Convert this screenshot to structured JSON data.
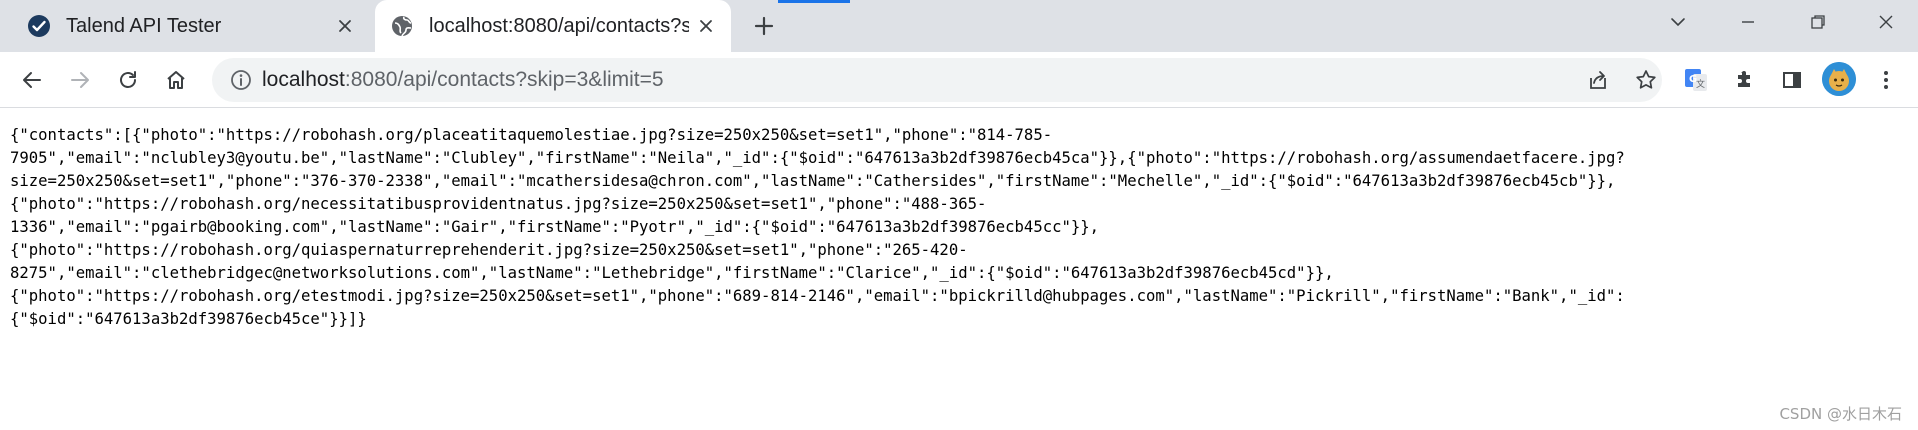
{
  "tabs": [
    {
      "title": "Talend API Tester",
      "favicon": "talend-check-icon",
      "active": false
    },
    {
      "title": "localhost:8080/api/contacts?skip=3&limit=5",
      "favicon": "globe-icon",
      "active": true
    }
  ],
  "address_bar": {
    "host": "localhost",
    "rest": ":8080/api/contacts?skip=3&limit=5"
  },
  "response_lines": [
    "{\"contacts\":[{\"photo\":\"https://robohash.org/placeatitaquemolestiae.jpg?size=250x250&set=set1\",\"phone\":\"814-785-",
    "7905\",\"email\":\"nclubley3@youtu.be\",\"lastName\":\"Clubley\",\"firstName\":\"Neila\",\"_id\":{\"$oid\":\"647613a3b2df39876ecb45ca\"}},{\"photo\":\"https://robohash.org/assumendaetfacere.jpg?",
    "size=250x250&set=set1\",\"phone\":\"376-370-2338\",\"email\":\"mcathersidesa@chron.com\",\"lastName\":\"Cathersides\",\"firstName\":\"Mechelle\",\"_id\":{\"$oid\":\"647613a3b2df39876ecb45cb\"}},",
    "{\"photo\":\"https://robohash.org/necessitatibusprovidentnatus.jpg?size=250x250&set=set1\",\"phone\":\"488-365-",
    "1336\",\"email\":\"pgairb@booking.com\",\"lastName\":\"Gair\",\"firstName\":\"Pyotr\",\"_id\":{\"$oid\":\"647613a3b2df39876ecb45cc\"}},",
    "{\"photo\":\"https://robohash.org/quiaspernaturreprehenderit.jpg?size=250x250&set=set1\",\"phone\":\"265-420-",
    "8275\",\"email\":\"clethebridgec@networksolutions.com\",\"lastName\":\"Lethebridge\",\"firstName\":\"Clarice\",\"_id\":{\"$oid\":\"647613a3b2df39876ecb45cd\"}},",
    "{\"photo\":\"https://robohash.org/etestmodi.jpg?size=250x250&set=set1\",\"phone\":\"689-814-2146\",\"email\":\"bpickrilld@hubpages.com\",\"lastName\":\"Pickrill\",\"firstName\":\"Bank\",\"_id\":",
    "{\"$oid\":\"647613a3b2df39876ecb45ce\"}}]}"
  ],
  "watermark": "CSDN @水日木石",
  "colors": {
    "tabstrip": "#dee1e6",
    "active_tab": "#ffffff",
    "omnibox": "#f1f3f4",
    "accent": "#1a73e8"
  }
}
